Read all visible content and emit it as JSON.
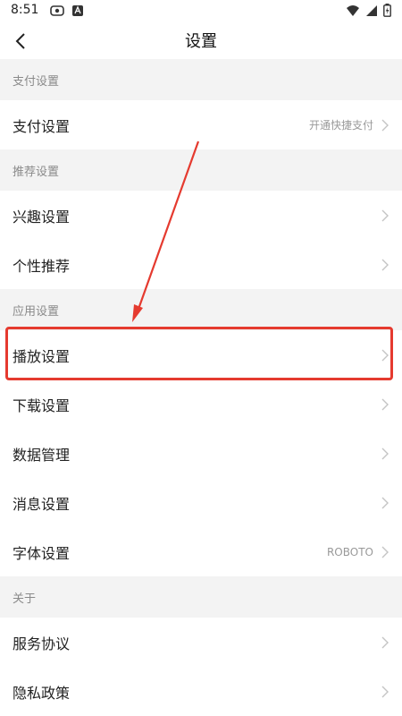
{
  "status": {
    "time": "8:51"
  },
  "header": {
    "title": "设置"
  },
  "sections": [
    {
      "title": "支付设置",
      "items": [
        {
          "label": "支付设置",
          "value": "开通快捷支付"
        }
      ]
    },
    {
      "title": "推荐设置",
      "items": [
        {
          "label": "兴趣设置",
          "value": ""
        },
        {
          "label": "个性推荐",
          "value": ""
        }
      ]
    },
    {
      "title": "应用设置",
      "items": [
        {
          "label": "播放设置",
          "value": ""
        },
        {
          "label": "下载设置",
          "value": ""
        },
        {
          "label": "数据管理",
          "value": ""
        },
        {
          "label": "消息设置",
          "value": ""
        },
        {
          "label": "字体设置",
          "value": "ROBOTO"
        }
      ]
    },
    {
      "title": "关于",
      "items": [
        {
          "label": "服务协议",
          "value": ""
        },
        {
          "label": "隐私政策",
          "value": ""
        }
      ]
    }
  ],
  "colors": {
    "accent": "#e53a2f",
    "section_bg": "#f3f3f3",
    "muted_text": "#8a8a8a"
  },
  "icons": [
    "back-icon",
    "chevron-right-icon",
    "wifi-icon",
    "signal-icon",
    "battery-icon"
  ]
}
